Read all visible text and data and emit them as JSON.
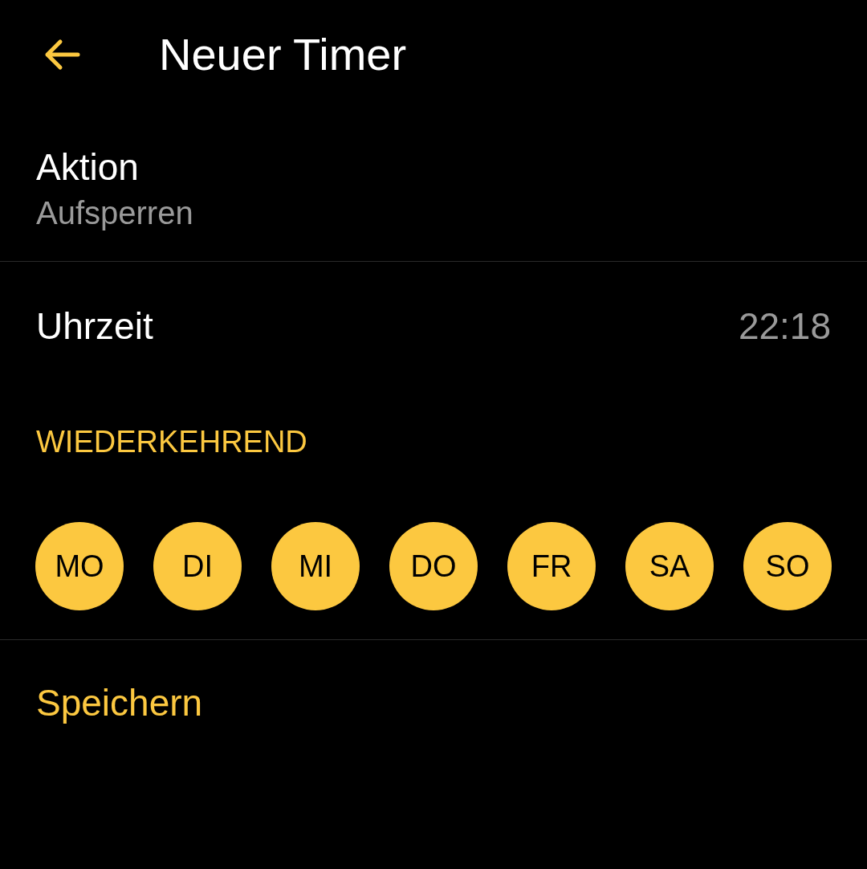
{
  "header": {
    "title": "Neuer Timer"
  },
  "action": {
    "label": "Aktion",
    "value": "Aufsperren"
  },
  "time": {
    "label": "Uhrzeit",
    "value": "22:18"
  },
  "recurring": {
    "heading": "WIEDERKEHREND",
    "days": [
      {
        "label": "MO",
        "selected": true
      },
      {
        "label": "DI",
        "selected": true
      },
      {
        "label": "MI",
        "selected": true
      },
      {
        "label": "DO",
        "selected": true
      },
      {
        "label": "FR",
        "selected": true
      },
      {
        "label": "SA",
        "selected": true
      },
      {
        "label": "SO",
        "selected": true
      }
    ]
  },
  "save_button": "Speichern"
}
